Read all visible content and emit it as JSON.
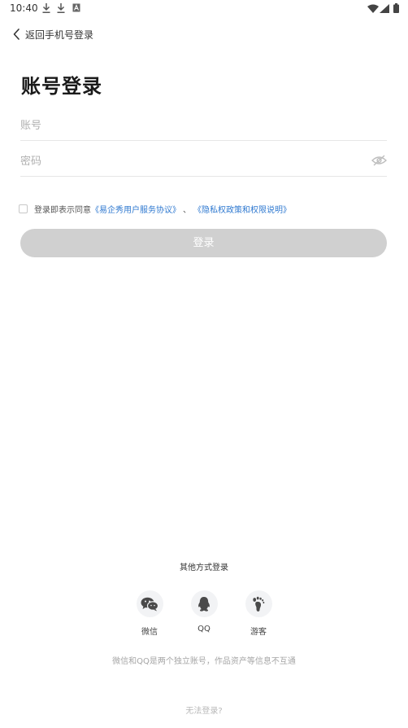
{
  "status_bar": {
    "time": "10:40"
  },
  "header": {
    "back_label": "返回手机号登录"
  },
  "page": {
    "title": "账号登录"
  },
  "form": {
    "account_placeholder": "账号",
    "account_value": "",
    "password_placeholder": "密码",
    "password_value": ""
  },
  "agreement": {
    "prefix": "登录即表示同意",
    "link1": "《易企秀用户服务协议》",
    "separator": "、",
    "link2": "《隐私权政策和权限说明》",
    "checked": false
  },
  "login_button": {
    "label": "登录"
  },
  "other_login": {
    "title": "其他方式登录",
    "options": [
      {
        "icon": "wechat-icon",
        "label": "微信"
      },
      {
        "icon": "qq-icon",
        "label": "QQ"
      },
      {
        "icon": "footprint-icon",
        "label": "游客"
      }
    ],
    "note": "微信和QQ是两个独立账号，作品资产等信息不互通"
  },
  "footer": {
    "cant_login": "无法登录?"
  },
  "colors": {
    "link": "#2f79d0",
    "button_disabled": "#d0d0d0",
    "divider": "#e6e6e6"
  }
}
